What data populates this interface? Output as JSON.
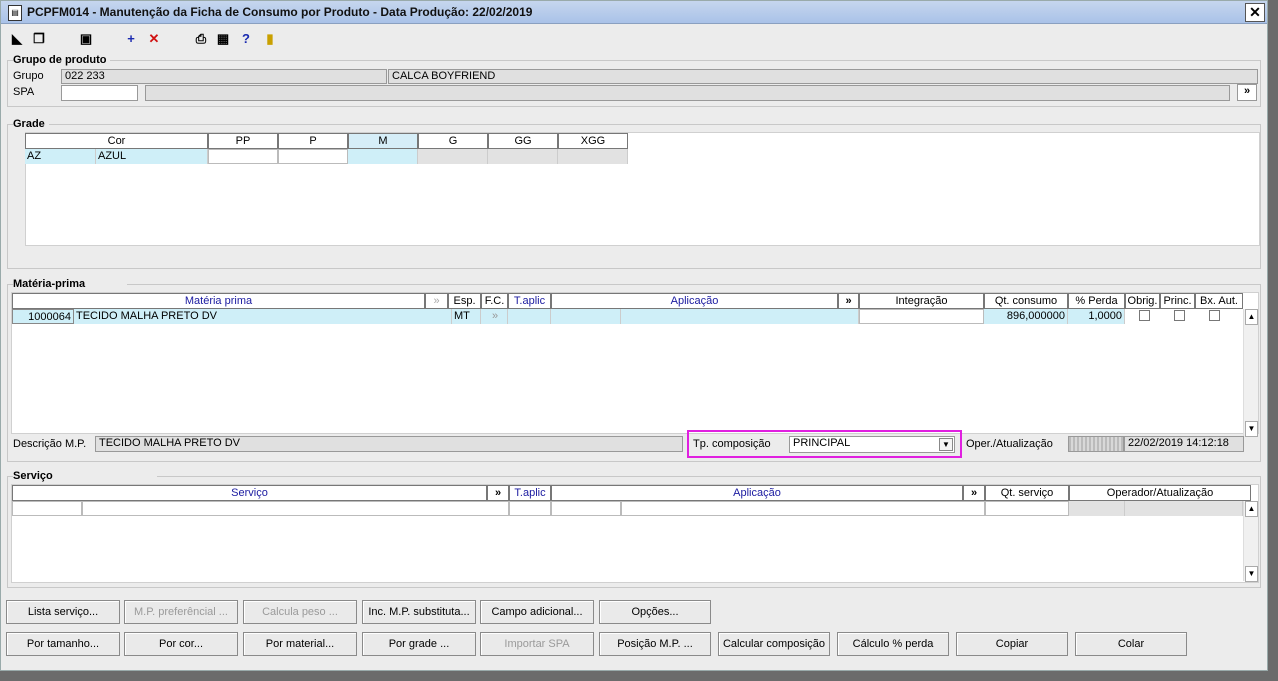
{
  "window": {
    "title": "PCPFM014 - Manutenção da Ficha de Consumo por Produto - Data Produção: 22/02/2019",
    "close": "✕"
  },
  "toolbar": {
    "icons": [
      "enter-icon",
      "copy-icon",
      "save-icon",
      "add-icon",
      "delete-icon",
      "print-icon",
      "calendar-icon",
      "help-icon",
      "exit-icon"
    ],
    "add": "+",
    "delete": "✕",
    "help": "?"
  },
  "grupo": {
    "legend": "Grupo de produto",
    "grupo_label": "Grupo",
    "grupo_code": "022 233",
    "grupo_desc": "CALCA BOYFRIEND",
    "spa_label": "SPA",
    "spa_value": "",
    "more": "»"
  },
  "grade": {
    "legend": "Grade",
    "headers": [
      "Cor",
      "PP",
      "P",
      "M",
      "G",
      "GG",
      "XGG"
    ],
    "row": {
      "code": "AZ",
      "color": "AZUL"
    }
  },
  "materia": {
    "legend": "Matéria-prima",
    "headers": {
      "materia": "Matéria prima",
      "esp": "Esp.",
      "fc": "F.C.",
      "taplic": "T.aplic",
      "aplicacao": "Aplicação",
      "more": "»",
      "integracao": "Integração",
      "qt": "Qt. consumo",
      "perda": "% Perda",
      "obrig": "Obrig.",
      "princ": "Princ.",
      "bxaut": "Bx. Aut."
    },
    "row": {
      "code": "1000064",
      "desc": "TECIDO MALHA PRETO DV",
      "esp": "MT",
      "qt": "896,000000",
      "perda": "1,0000"
    },
    "descricao_label": "Descrição M.P.",
    "descricao_value": "TECIDO MALHA PRETO DV",
    "tp_label": "Tp. composição",
    "tp_value": "PRINCIPAL",
    "oper_label": "Oper./Atualização",
    "oper_value": "22/02/2019 14:12:18"
  },
  "servico": {
    "legend": "Serviço",
    "headers": {
      "servico": "Serviço",
      "more": "»",
      "taplic": "T.aplic",
      "aplicacao": "Aplicação",
      "more2": "»",
      "qt": "Qt. serviço",
      "oper": "Operador/Atualização"
    }
  },
  "buttons": {
    "row1": [
      "Lista serviço...",
      "M.P. preferêncial ...",
      "Calcula peso ...",
      "Inc. M.P. substituta...",
      "Campo adicional...",
      "Opções..."
    ],
    "row2": [
      "Por tamanho...",
      "Por cor...",
      "Por material...",
      "Por grade ...",
      "Importar SPA",
      "Posição M.P. ...",
      "Calcular composição",
      "Cálculo % perda",
      "Copiar",
      "Colar"
    ]
  }
}
